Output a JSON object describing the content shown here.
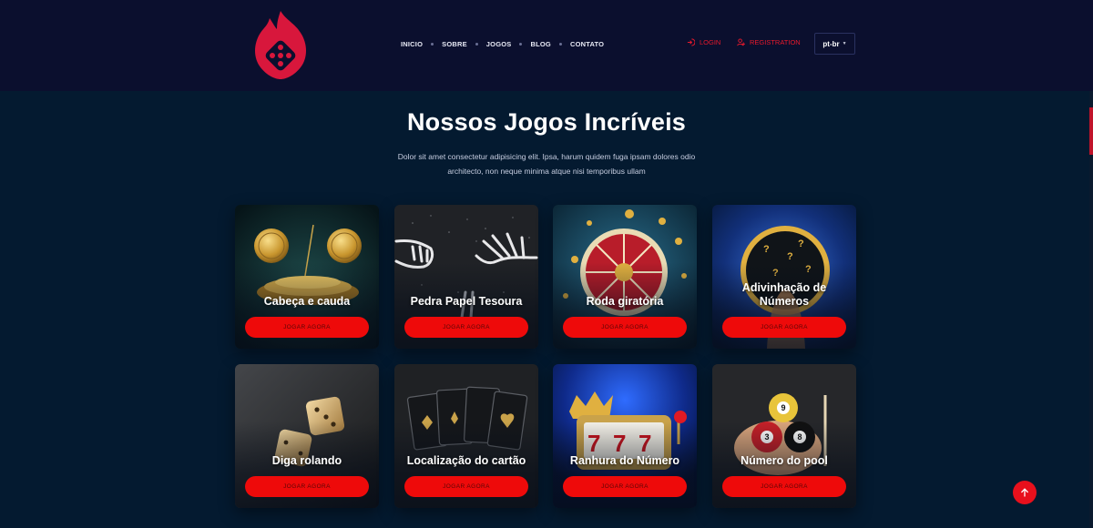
{
  "nav": {
    "items": [
      {
        "label": "INICIO"
      },
      {
        "label": "SOBRE"
      },
      {
        "label": "JOGOS"
      },
      {
        "label": "BLOG"
      },
      {
        "label": "CONTATO"
      }
    ]
  },
  "auth": {
    "login_label": "LOGIN",
    "register_label": "REGISTRATION",
    "accent": "#e8192c"
  },
  "language": {
    "selected": "pt-br"
  },
  "section": {
    "title": "Nossos Jogos Incríveis",
    "description": "Dolor sit amet consectetur adipisicing elit. Ipsa, harum quidem fuga ipsam dolores odio architecto, non neque minima atque nisi temporibus ullam"
  },
  "games": [
    {
      "title": "Cabeça e cauda",
      "button": "JOGAR AGORA",
      "icon": "coins-icon"
    },
    {
      "title": "Pedra Papel Tesoura",
      "button": "JOGAR AGORA",
      "icon": "skeleton-hands-icon"
    },
    {
      "title": "Roda giratória",
      "button": "JOGAR AGORA",
      "icon": "roulette-wheel-icon"
    },
    {
      "title": "Adivinhação de Números",
      "button": "JOGAR AGORA",
      "icon": "question-portal-icon"
    },
    {
      "title": "Diga rolando",
      "button": "JOGAR AGORA",
      "icon": "dice-icon"
    },
    {
      "title": "Localização do cartão",
      "button": "JOGAR AGORA",
      "icon": "cards-icon"
    },
    {
      "title": "Ranhura do Número",
      "button": "JOGAR AGORA",
      "icon": "slot-machine-icon"
    },
    {
      "title": "Número do pool",
      "button": "JOGAR AGORA",
      "icon": "pool-balls-icon"
    }
  ],
  "colors": {
    "background": "#041a30",
    "header": "#0b0f2e",
    "button": "#ee0a0a",
    "accent": "#e8192c"
  }
}
